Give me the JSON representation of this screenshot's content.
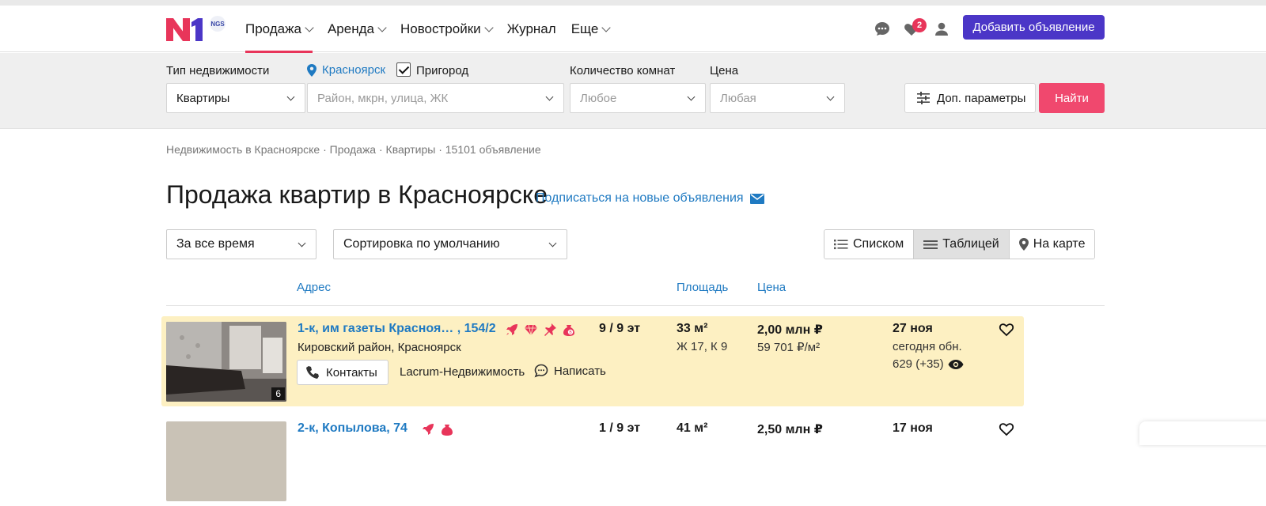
{
  "header": {
    "nav": [
      {
        "label": "Продажа",
        "dropdown": true,
        "active": true
      },
      {
        "label": "Аренда",
        "dropdown": true
      },
      {
        "label": "Новостройки",
        "dropdown": true
      },
      {
        "label": "Журнал",
        "dropdown": false
      },
      {
        "label": "Еще",
        "dropdown": true
      }
    ],
    "favorites_count": "2",
    "add_button": "Добавить объявление",
    "logo_text": "NGS"
  },
  "filters": {
    "type_label": "Тип недвижимости",
    "type_value": "Квартиры",
    "city": "Красноярск",
    "suburb_label": "Пригород",
    "suburb_checked": true,
    "location_placeholder": "Район, мкрн, улица, ЖК",
    "rooms_label": "Количество комнат",
    "rooms_value": "Любое",
    "price_label": "Цена",
    "price_value": "Любая",
    "params_button": "Доп. параметры",
    "find_button": "Найти"
  },
  "breadcrumb": "Недвижимость в Красноярске · Продажа · Квартиры · 15101 объявление",
  "page_title": "Продажа квартир в Красноярске",
  "subscribe_link": "Подписаться на новые объявления",
  "controls": {
    "period": "За все время",
    "sort": "Сортировка по умолчанию",
    "views": [
      {
        "label": "Списком",
        "active": false
      },
      {
        "label": "Таблицей",
        "active": true
      },
      {
        "label": "На карте",
        "active": false
      }
    ]
  },
  "columns": {
    "address": "Адрес",
    "area": "Площадь",
    "price": "Цена"
  },
  "listings": [
    {
      "title": "1-к, им газеты Красноя…  , 154/2",
      "floor": "9 / 9 эт",
      "district": "Кировский район, Красноярск",
      "contacts": "Контакты",
      "agency": "Lacrum-Недвижимость",
      "write": "Написать",
      "area": "33 м²",
      "area_sub": "Ж 17, К 9",
      "price": "2,00 млн ₽",
      "price_per_m": "59 701 ₽/м²",
      "date": "27 ноя",
      "updated": "сегодня обн.",
      "views": "629 (+35)",
      "photos": "6",
      "highlighted": true
    },
    {
      "title": "2-к, Копылова, 74",
      "floor": "1 / 9 эт",
      "area": "41 м²",
      "price": "2,50 млн ₽",
      "date": "17 ноя",
      "highlighted": false
    }
  ],
  "colors": {
    "accent_pink": "#e8355a",
    "link_blue": "#1f7ac2",
    "brand_purple": "#4b36c7",
    "highlight": "#fdf0c2"
  }
}
